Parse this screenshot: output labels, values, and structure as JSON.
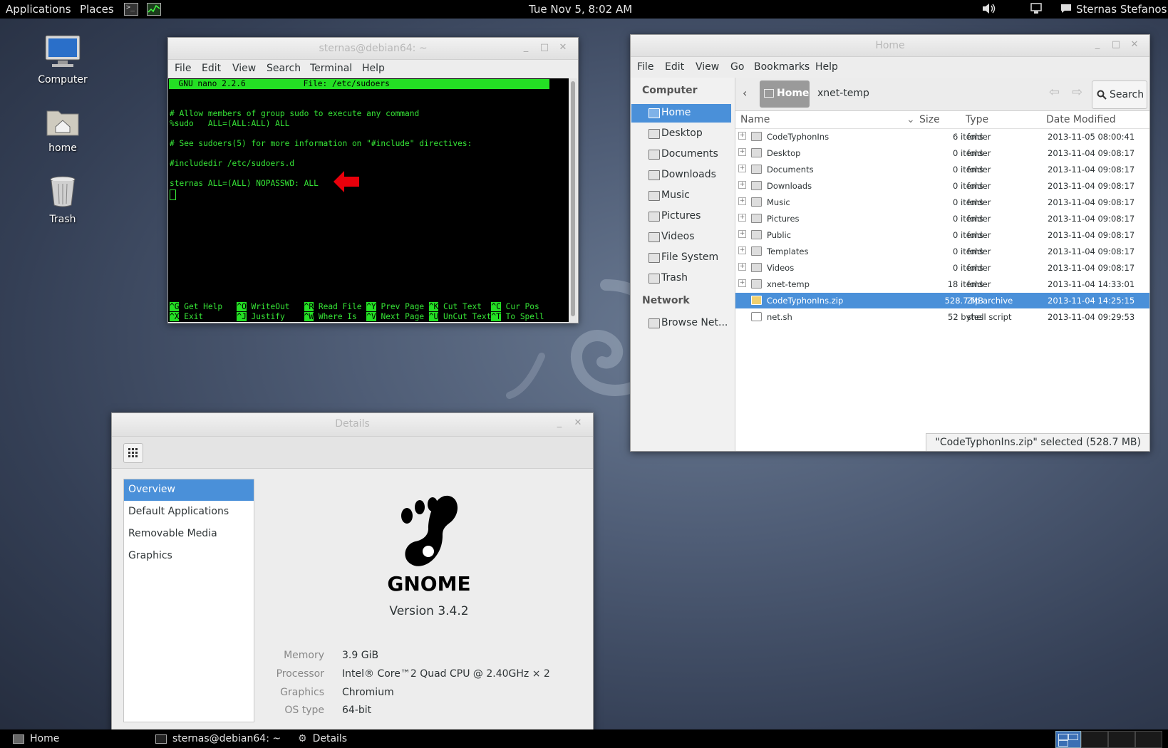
{
  "topbar": {
    "applications": "Applications",
    "places": "Places",
    "clock": "Tue Nov  5,  8:02 AM",
    "user": "Sternas Stefanos"
  },
  "desktop": {
    "icons": [
      {
        "label": "Computer",
        "icon": "computer-icon"
      },
      {
        "label": "home",
        "icon": "home-folder-icon"
      },
      {
        "label": "Trash",
        "icon": "trash-icon"
      }
    ]
  },
  "terminal": {
    "title": "sternas@debian64: ~",
    "menu": [
      "File",
      "Edit",
      "View",
      "Search",
      "Terminal",
      "Help"
    ],
    "nano_header": "  GNU nano 2.2.6            File: /etc/sudoers",
    "lines": [
      "",
      "",
      "# Allow members of group sudo to execute any command",
      "%sudo   ALL=(ALL:ALL) ALL",
      "",
      "# See sudoers(5) for more information on \"#include\" directives:",
      "",
      "#includedir /etc/sudoers.d",
      "",
      "sternas ALL=(ALL) NOPASSWD: ALL"
    ],
    "shortcuts_row1": [
      {
        "key": "^G",
        "label": " Get Help  "
      },
      {
        "key": "^O",
        "label": " WriteOut  "
      },
      {
        "key": "^R",
        "label": " Read File "
      },
      {
        "key": "^Y",
        "label": " Prev Page "
      },
      {
        "key": "^K",
        "label": " Cut Text  "
      },
      {
        "key": "^C",
        "label": " Cur Pos"
      }
    ],
    "shortcuts_row2": [
      {
        "key": "^X",
        "label": " Exit      "
      },
      {
        "key": "^J",
        "label": " Justify   "
      },
      {
        "key": "^W",
        "label": " Where Is  "
      },
      {
        "key": "^V",
        "label": " Next Page "
      },
      {
        "key": "^U",
        "label": " UnCut Text"
      },
      {
        "key": "^T",
        "label": " To Spell"
      }
    ],
    "arrow_color": "#e8000b"
  },
  "file_manager": {
    "title": "Home",
    "menu": [
      "File",
      "Edit",
      "View",
      "Go",
      "Bookmarks",
      "Help"
    ],
    "sidebar": {
      "computer_heading": "Computer",
      "items": [
        "Home",
        "Desktop",
        "Documents",
        "Downloads",
        "Music",
        "Pictures",
        "Videos",
        "File System",
        "Trash"
      ],
      "network_heading": "Network",
      "network_items": [
        "Browse Net..."
      ]
    },
    "path": [
      "Home",
      "xnet-temp"
    ],
    "search_label": "Search",
    "columns": [
      "Name",
      "Size",
      "Type",
      "Date Modified"
    ],
    "rows": [
      {
        "name": "CodeTyphonIns",
        "size": "6 items",
        "type": "folder",
        "date": "2013-11-05 08:00:41"
      },
      {
        "name": "Desktop",
        "size": "0 items",
        "type": "folder",
        "date": "2013-11-04 09:08:17"
      },
      {
        "name": "Documents",
        "size": "0 items",
        "type": "folder",
        "date": "2013-11-04 09:08:17"
      },
      {
        "name": "Downloads",
        "size": "0 items",
        "type": "folder",
        "date": "2013-11-04 09:08:17"
      },
      {
        "name": "Music",
        "size": "0 items",
        "type": "folder",
        "date": "2013-11-04 09:08:17"
      },
      {
        "name": "Pictures",
        "size": "0 items",
        "type": "folder",
        "date": "2013-11-04 09:08:17"
      },
      {
        "name": "Public",
        "size": "0 items",
        "type": "folder",
        "date": "2013-11-04 09:08:17"
      },
      {
        "name": "Templates",
        "size": "0 items",
        "type": "folder",
        "date": "2013-11-04 09:08:17"
      },
      {
        "name": "Videos",
        "size": "0 items",
        "type": "folder",
        "date": "2013-11-04 09:08:17"
      },
      {
        "name": "xnet-temp",
        "size": "18 items",
        "type": "folder",
        "date": "2013-11-04 14:33:01"
      },
      {
        "name": "CodeTyphonIns.zip",
        "size": "528.7 MB",
        "type": "Zip archive",
        "date": "2013-11-04 14:25:15"
      },
      {
        "name": "net.sh",
        "size": "52 bytes",
        "type": "shell script",
        "date": "2013-11-04 09:29:53"
      }
    ],
    "status": "\"CodeTyphonIns.zip\" selected (528.7 MB)"
  },
  "details": {
    "title": "Details",
    "nav": [
      "Overview",
      "Default Applications",
      "Removable Media",
      "Graphics"
    ],
    "logo_text": "GNOME",
    "version": "Version 3.4.2",
    "info": [
      {
        "label": "Memory",
        "value": "3.9 GiB"
      },
      {
        "label": "Processor",
        "value": "Intel® Core™2 Quad CPU @ 2.40GHz × 2"
      },
      {
        "label": "Graphics",
        "value": "Chromium"
      },
      {
        "label": "OS type",
        "value": "64-bit"
      }
    ]
  },
  "taskbar": {
    "tasks": [
      "Home",
      "sternas@debian64: ~",
      "Details"
    ]
  },
  "colors": {
    "selection": "#4a90d9",
    "terminal_green": "#36e436"
  }
}
